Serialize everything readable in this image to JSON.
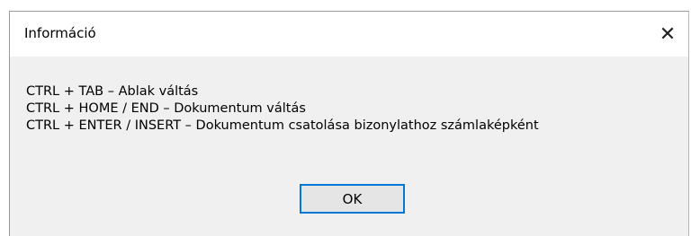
{
  "dialog": {
    "title": "Információ",
    "close_symbol": "✕",
    "messages": [
      "CTRL + TAB  –  Ablak váltás",
      "CTRL + HOME / END  –  Dokumentum váltás",
      "CTRL + ENTER / INSERT  –  Dokumentum csatolása bizonylathoz számlaképként"
    ],
    "ok_label": "OK"
  },
  "colors": {
    "titlebar_bg": "#ffffff",
    "body_bg": "#f0f0f0",
    "button_focus_border": "#0078d7",
    "button_bg": "#e5e5e5"
  }
}
